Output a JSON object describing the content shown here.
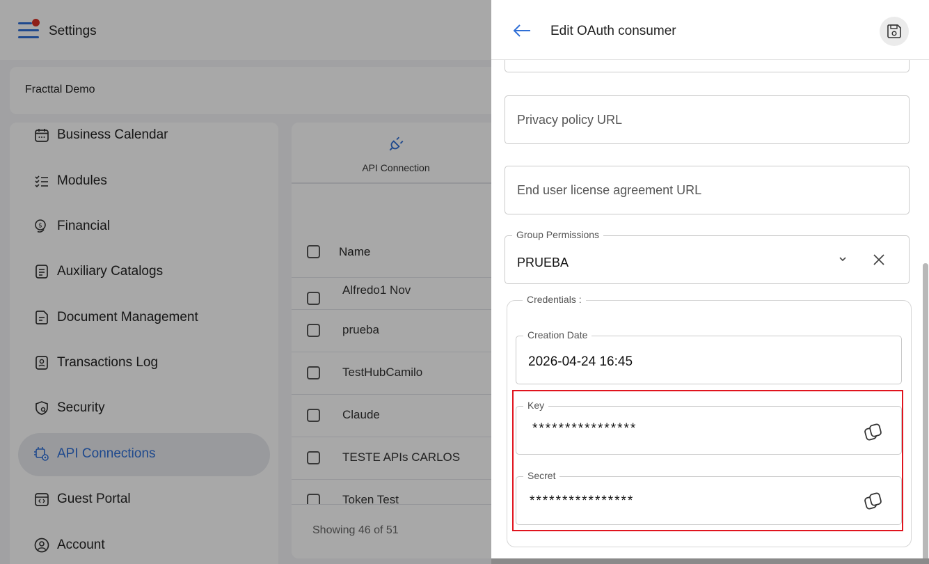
{
  "app": {
    "title": "Settings",
    "company": "Fracttal Demo",
    "accent_color": "#2f6fd6",
    "notification_dot_color": "#d93025"
  },
  "sidebar": {
    "items": [
      {
        "label": "Business Calendar",
        "icon": "calendar-icon",
        "active": false
      },
      {
        "label": "Modules",
        "icon": "checklist-icon",
        "active": false
      },
      {
        "label": "Financial",
        "icon": "coins-icon",
        "active": false
      },
      {
        "label": "Auxiliary Catalogs",
        "icon": "catalog-icon",
        "active": false
      },
      {
        "label": "Document Management",
        "icon": "document-icon",
        "active": false
      },
      {
        "label": "Transactions Log",
        "icon": "log-icon",
        "active": false
      },
      {
        "label": "Security",
        "icon": "shield-icon",
        "active": false
      },
      {
        "label": "API Connections",
        "icon": "api-gear-icon",
        "active": true
      },
      {
        "label": "Guest Portal",
        "icon": "portal-icon",
        "active": false
      },
      {
        "label": "Account",
        "icon": "account-icon",
        "active": false
      }
    ]
  },
  "main": {
    "tab_label": "API Connection",
    "column_name": "Name",
    "rows": [
      "Alfredo1 Nov",
      "prueba",
      "TestHubCamilo",
      "Claude",
      "TESTE APIs CARLOS",
      "Token Test"
    ],
    "showing": "Showing 46 of 51"
  },
  "panel": {
    "title": "Edit OAuth consumer",
    "privacy_placeholder": "Privacy policy URL",
    "eula_placeholder": "End user license agreement URL",
    "group_permissions": {
      "label": "Group Permissions",
      "value": "PRUEBA"
    },
    "credentials_label": "Credentials :",
    "creation_date": {
      "label": "Creation Date",
      "value": "2026-04-24 16:45"
    },
    "key": {
      "label": "Key",
      "value": "****************"
    },
    "secret": {
      "label": "Secret",
      "value": "****************"
    },
    "highlight_color": "#e0141e"
  }
}
